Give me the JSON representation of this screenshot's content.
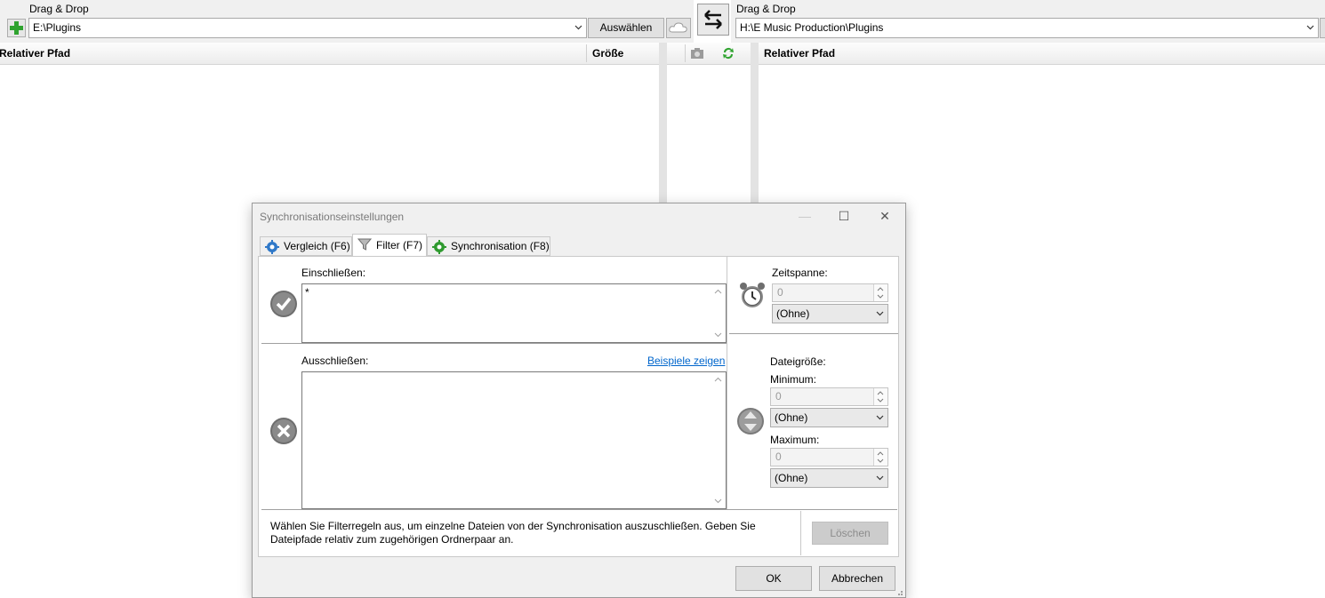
{
  "left": {
    "drag_drop_label": "Drag & Drop",
    "path_value": "E:\\Plugins",
    "select_button": "Auswählen",
    "header_path": "Relativer Pfad",
    "header_size": "Größe"
  },
  "right": {
    "drag_drop_label": "Drag & Drop",
    "path_value": "H:\\E Music Production\\Plugins",
    "header_path": "Relativer Pfad"
  },
  "dialog": {
    "title": "Synchronisationseinstellungen",
    "tabs": [
      {
        "label": "Vergleich (F6)",
        "icon": "gear-blue-icon"
      },
      {
        "label": "Filter (F7)",
        "icon": "funnel-icon"
      },
      {
        "label": "Synchronisation (F8)",
        "icon": "gear-green-icon"
      }
    ],
    "include": {
      "label": "Einschließen:",
      "value": "*"
    },
    "exclude": {
      "label": "Ausschließen:",
      "value": "",
      "examples_link": "Beispiele zeigen"
    },
    "timespan": {
      "label": "Zeitspanne:",
      "value": "0",
      "unit": "(Ohne)"
    },
    "filesize": {
      "label": "Dateigröße:",
      "min_label": "Minimum:",
      "min_value": "0",
      "min_unit": "(Ohne)",
      "max_label": "Maximum:",
      "max_value": "0",
      "max_unit": "(Ohne)"
    },
    "help_text": "Wählen Sie Filterregeln aus, um einzelne Dateien von der Synchronisation auszuschließen. Geben Sie Dateipfade relativ zum zugehörigen Ordnerpaar an.",
    "clear_button": "Löschen",
    "ok_button": "OK",
    "cancel_button": "Abbrechen"
  }
}
